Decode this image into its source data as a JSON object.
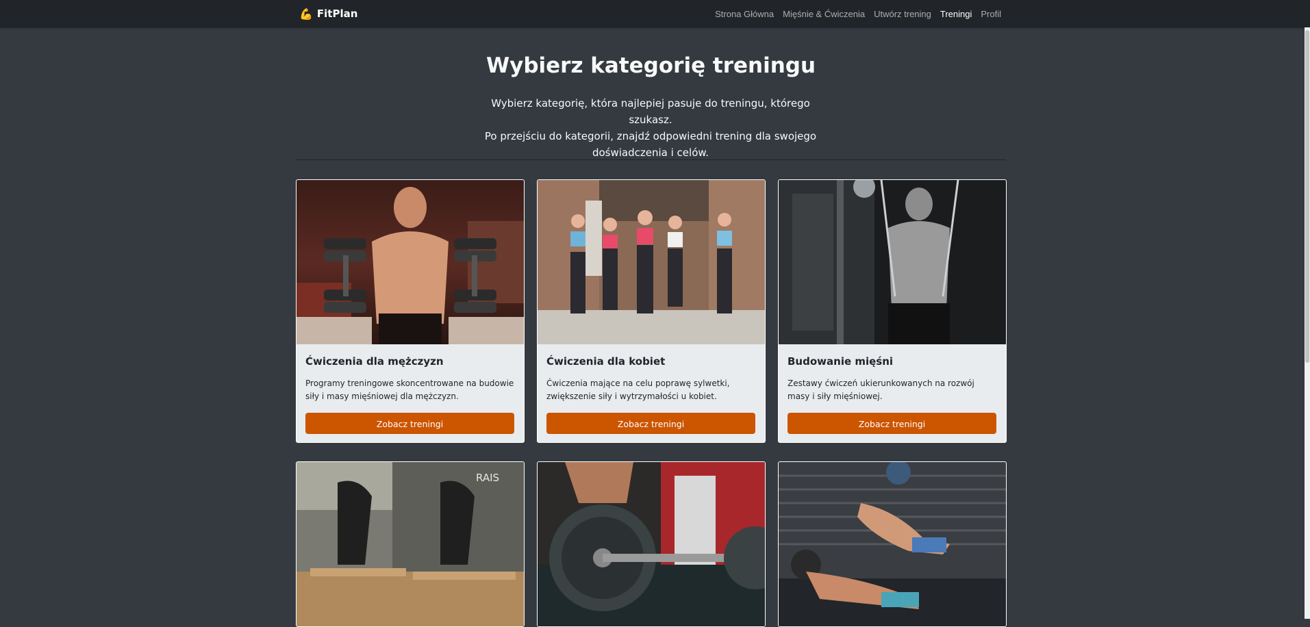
{
  "navbar": {
    "brand": "FitPlan",
    "links": [
      {
        "label": "Strona Główna",
        "active": false
      },
      {
        "label": "Mięśnie & Ćwiczenia",
        "active": false
      },
      {
        "label": "Utwórz trening",
        "active": false
      },
      {
        "label": "Treningi",
        "active": true
      },
      {
        "label": "Profil",
        "active": false
      }
    ]
  },
  "header": {
    "title": "Wybierz kategorię treningu",
    "lead_line1": "Wybierz kategorię, która najlepiej pasuje do treningu, którego szukasz.",
    "lead_line2": "Po przejściu do kategorii, znajdź odpowiedni trening dla swojego",
    "lead_line3": "doświadczenia i celów."
  },
  "cards": [
    {
      "title": "Ćwiczenia dla mężczyzn",
      "text": "Programy treningowe skoncentrowane na budowie siły i masy mięśniowej dla mężczyzn.",
      "button": "Zobacz treningi"
    },
    {
      "title": "Ćwiczenia dla kobiet",
      "text": "Ćwiczenia mające na celu poprawę sylwetki, zwiększenie siły i wytrzymałości u kobiet.",
      "button": "Zobacz treningi"
    },
    {
      "title": "Budowanie mięśni",
      "text": "Zestawy ćwiczeń ukierunkowanych na rozwój masy i siły mięśniowej.",
      "button": "Zobacz treningi"
    }
  ],
  "colors": {
    "page_bg": "#343a40",
    "navbar_bg": "#212529",
    "card_bg": "#e9ecef",
    "button_bg": "#cc5500"
  }
}
